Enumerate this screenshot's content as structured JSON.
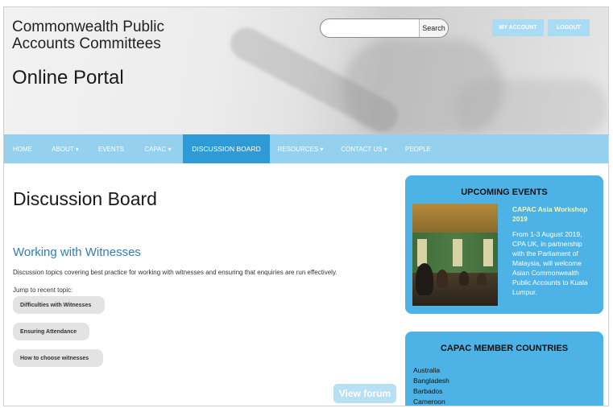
{
  "header": {
    "site_title": "Commonwealth Public Accounts Committees",
    "portal_title": "Online Portal",
    "search": {
      "placeholder": "",
      "button_label": "Search"
    },
    "my_account_label": "MY ACCOUNT",
    "logout_label": "LOGOUT"
  },
  "nav": {
    "items": [
      {
        "label": "HOME"
      },
      {
        "label": "ABOUT ▾"
      },
      {
        "label": "EVENTS"
      },
      {
        "label": "CAPAC ▾"
      },
      {
        "label": "DISCUSSION BOARD",
        "active": true
      },
      {
        "label": "RESOURCES ▾"
      },
      {
        "label": "CONTACT US ▾"
      },
      {
        "label": "PEOPLE"
      }
    ]
  },
  "main": {
    "page_title": "Discussion Board",
    "forum": {
      "title": "Working with Witnesses",
      "description": "Discussion topics covering best practice for working with witnesses and ensuring that enquiries are run effectively.",
      "jump_label": "Jump to recent topic:",
      "topics": [
        {
          "label": "Difficulties with Witnesses"
        },
        {
          "label": "Ensuring Attendance"
        },
        {
          "label": "How to choose witnesses"
        }
      ],
      "view_forum_label": "View forum"
    }
  },
  "sidebar": {
    "events": {
      "heading": "UPCOMING EVENTS",
      "event_title": "CAPAC Asia Workshop 2019",
      "event_desc": "From 1-3 August 2019, CPA UK, in partnership with the Parliament of Malaysia, will welcome Asian Commonwealth Public Accounts to Kuala Lumpur."
    },
    "members": {
      "heading": "CAPAC MEMBER COUNTRIES",
      "countries": [
        "Australia",
        "Bangladesh",
        "Barbados",
        "Cameroon"
      ]
    }
  },
  "colors": {
    "nav_background": "#93d1ef",
    "nav_active": "#2f9bd6",
    "panel_background": "#4db3e6",
    "forum_title": "#2e7fb5",
    "event_title": "#fff6a8"
  }
}
